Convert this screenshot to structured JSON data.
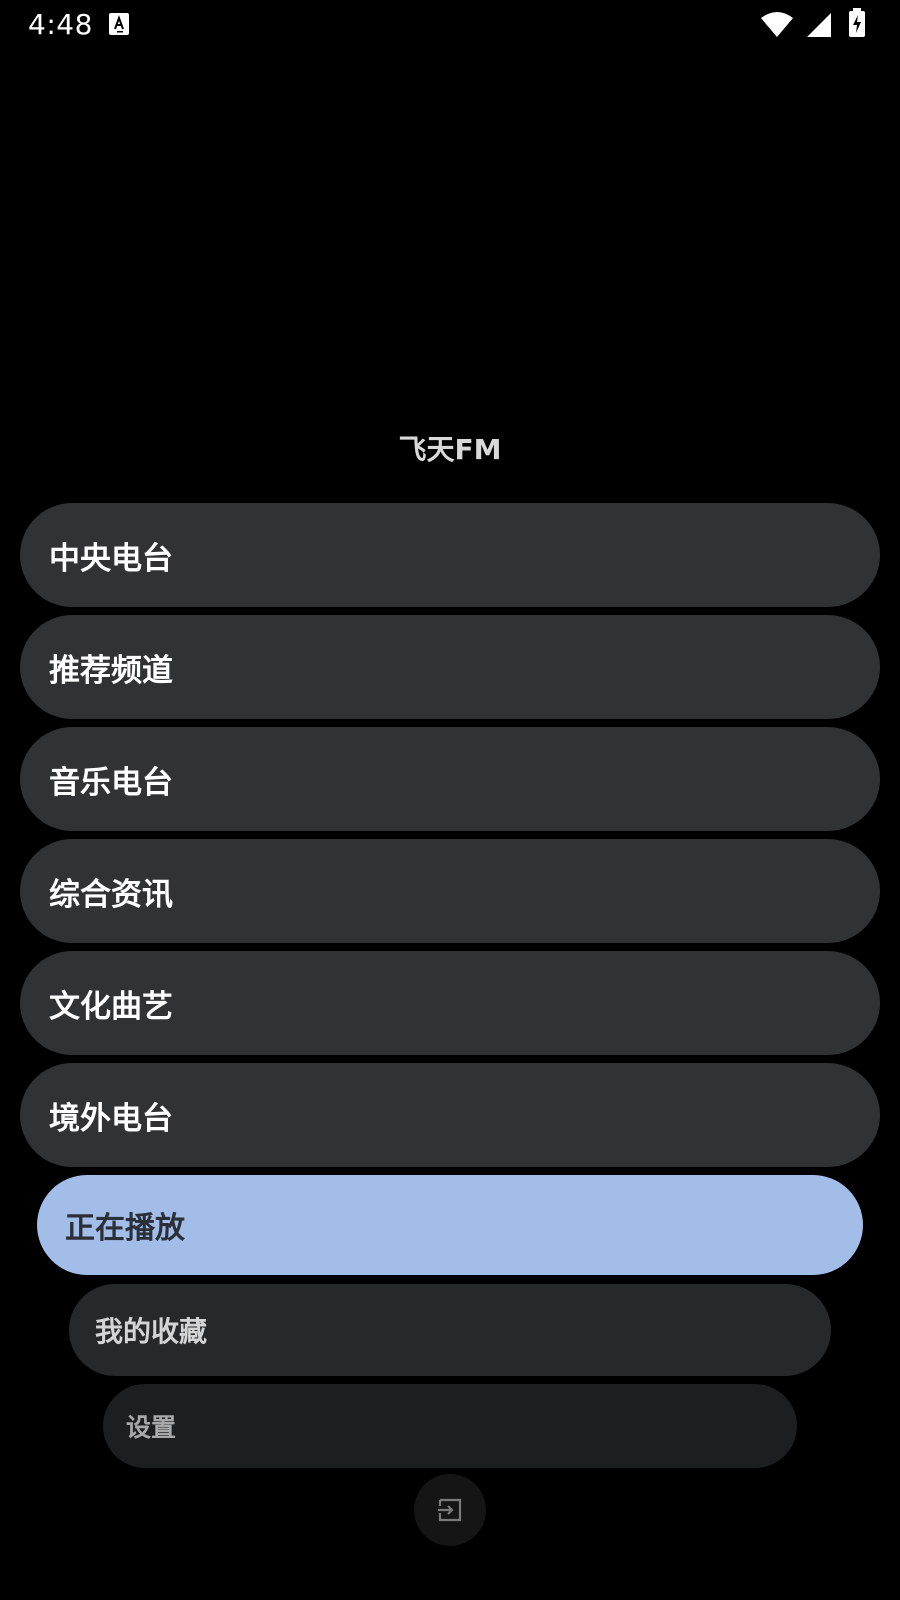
{
  "status_bar": {
    "time": "4:48",
    "icons": [
      "notification-a-icon",
      "wifi-icon",
      "cell-signal-icon",
      "battery-charging-icon"
    ]
  },
  "app": {
    "title": "飞天FM"
  },
  "menu": {
    "items": [
      {
        "label": "中央电台"
      },
      {
        "label": "推荐频道"
      },
      {
        "label": "音乐电台"
      },
      {
        "label": "综合资讯"
      },
      {
        "label": "文化曲艺"
      },
      {
        "label": "境外电台"
      }
    ],
    "now_playing": {
      "label": "正在播放",
      "color": "#a3bde9"
    },
    "favorites": {
      "label": "我的收藏"
    },
    "settings": {
      "label": "设置"
    },
    "exit": {
      "icon": "exit-icon"
    }
  },
  "colors": {
    "background": "#000000",
    "pill": "#313234",
    "accent": "#a3bde9"
  }
}
